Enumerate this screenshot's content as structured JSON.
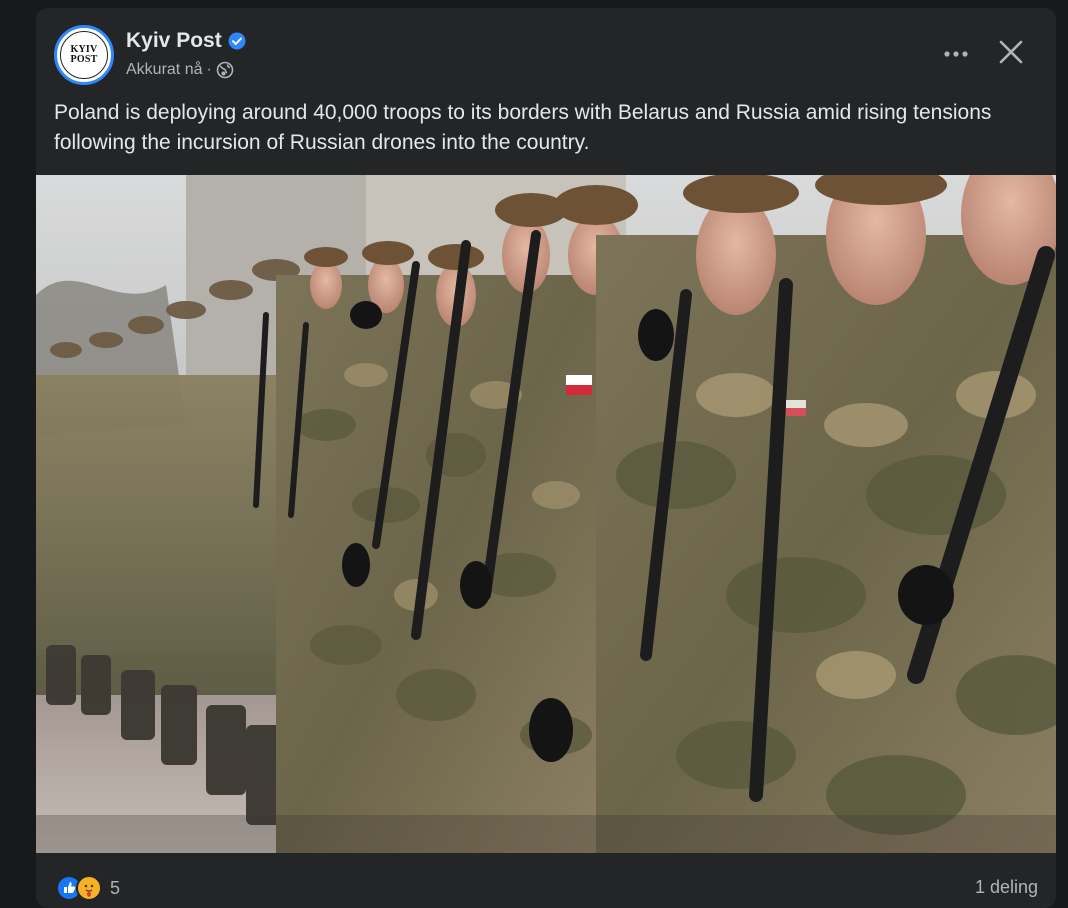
{
  "post": {
    "page_name": "Kyiv Post",
    "timestamp": "Akkurat nå",
    "separator": "·",
    "audience_icon": "globe-icon",
    "verified_icon": "verified-badge-icon",
    "text": "Poland is deploying around 40,000 troops to its borders with Belarus and Russia amid rising tensions following the incursion of Russian drones into the country.",
    "avatar": {
      "line1": "KYIV",
      "line2": "POST"
    },
    "actions": {
      "more_icon": "more-options-icon",
      "close_icon": "close-icon"
    },
    "image": {
      "subject": "photo"
    }
  },
  "footer": {
    "reactions": [
      "like-reaction-icon",
      "care-reaction-icon"
    ],
    "reaction_count": "5",
    "shares": "1 deling"
  },
  "colors": {
    "background": "#18191a",
    "card": "#242526",
    "text_primary": "#e4e6eb",
    "text_secondary": "#b0b3b8",
    "accent": "#2d88ff"
  }
}
